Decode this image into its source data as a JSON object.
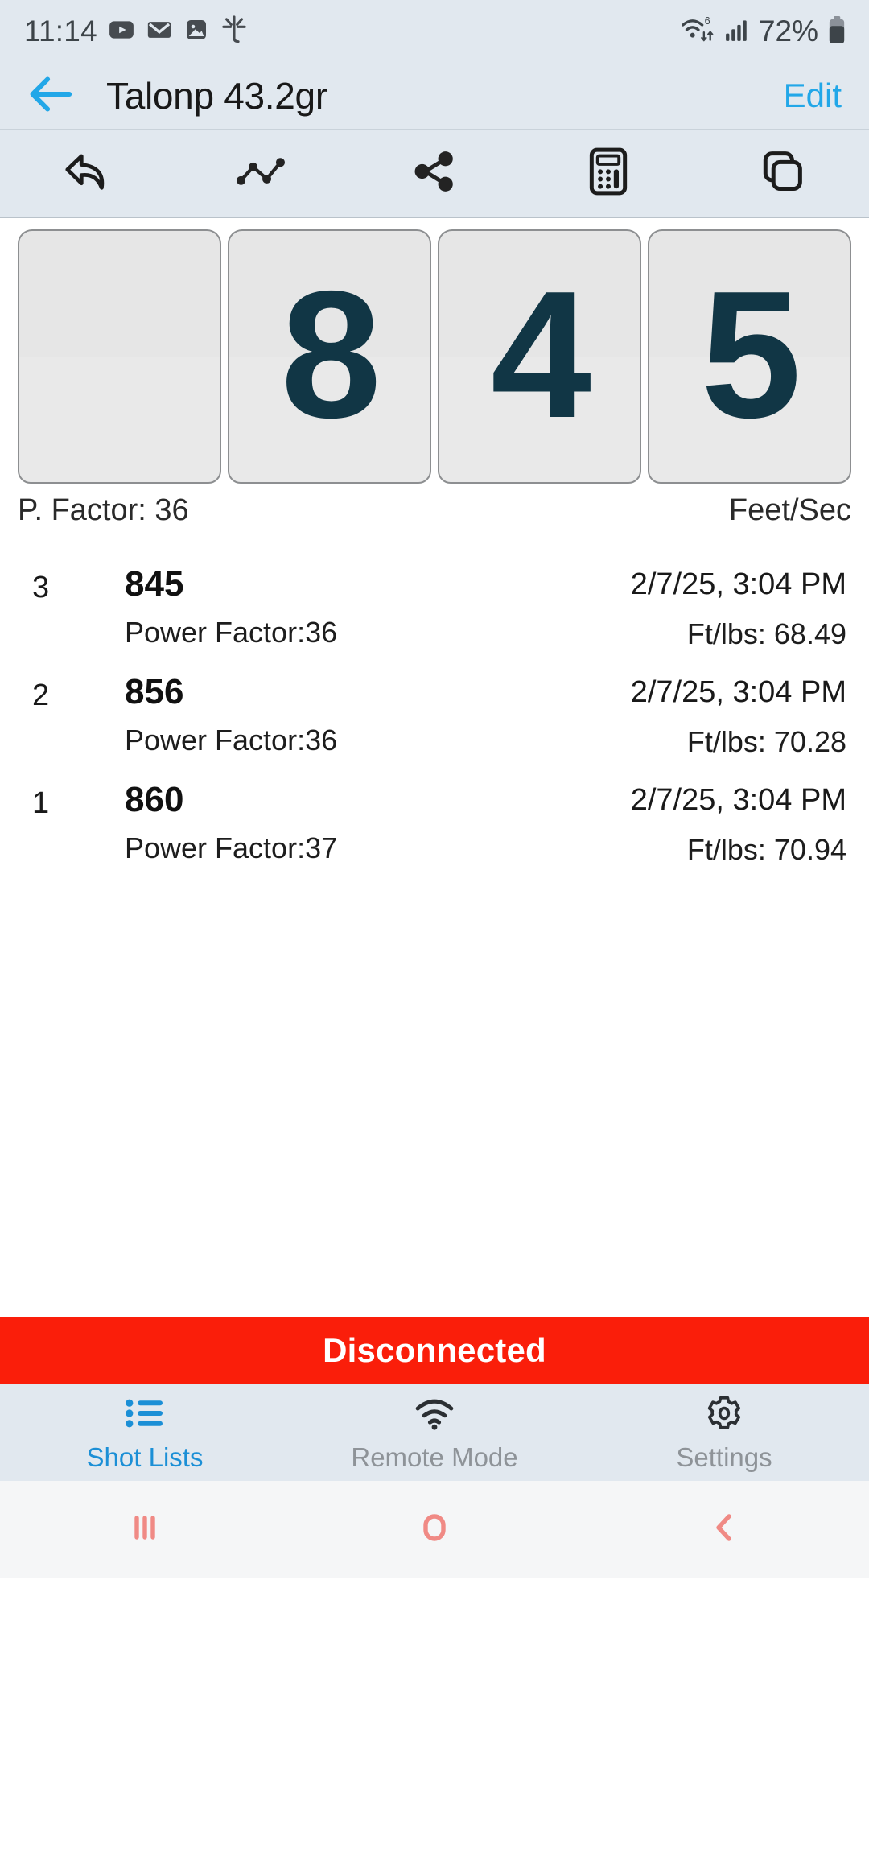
{
  "status_bar": {
    "time": "11:14",
    "battery_percent": "72%",
    "left_icons": [
      "youtube-icon",
      "email-icon",
      "gallery-image-icon",
      "spark-app-icon"
    ],
    "right_icons": [
      "wifi-6-icon",
      "cellular-signal-icon",
      "battery-icon"
    ]
  },
  "app_bar": {
    "back_icon": "back-arrow-icon",
    "title": "Talonp 43.2gr",
    "edit_label": "Edit",
    "accent_color": "#22a7e8",
    "background": "#e1e8ef"
  },
  "toolbar": {
    "items": [
      {
        "icon": "undo-reply-arrow-icon",
        "name": "undo-button"
      },
      {
        "icon": "line-chart-icon",
        "name": "chart-button"
      },
      {
        "icon": "share-icon",
        "name": "share-button"
      },
      {
        "icon": "calculator-icon",
        "name": "calculator-button"
      },
      {
        "icon": "copy-duplicate-icon",
        "name": "duplicate-button"
      }
    ]
  },
  "speed_display": {
    "digits": [
      "",
      "8",
      "4",
      "5"
    ],
    "value": "845",
    "power_factor_label": "P. Factor: 36",
    "units_label": "Feet/Sec",
    "digit_color": "#113645"
  },
  "shot_list": {
    "rows": [
      {
        "index": "3",
        "speed": "845",
        "power_factor": "Power Factor:36",
        "date": "2/7/25, 3:04 PM",
        "energy": "Ft/lbs: 68.49"
      },
      {
        "index": "2",
        "speed": "856",
        "power_factor": "Power Factor:36",
        "date": "2/7/25, 3:04 PM",
        "energy": "Ft/lbs: 70.28"
      },
      {
        "index": "1",
        "speed": "860",
        "power_factor": "Power Factor:37",
        "date": "2/7/25, 3:04 PM",
        "energy": "Ft/lbs: 70.94"
      }
    ]
  },
  "connection_banner": {
    "text": "Disconnected",
    "background": "#fa1e0a",
    "text_color": "#ffffff"
  },
  "tab_bar": {
    "active_color": "#1b8fd6",
    "inactive_color": "#8e9398",
    "tabs": [
      {
        "label": "Shot Lists",
        "icon": "list-icon",
        "active": true
      },
      {
        "label": "Remote Mode",
        "icon": "wifi-icon",
        "active": false
      },
      {
        "label": "Settings",
        "icon": "gear-icon",
        "active": false
      }
    ]
  },
  "android_nav": {
    "button_color": "#f08a85",
    "buttons": [
      {
        "icon": "recents-icon",
        "name": "recents-button"
      },
      {
        "icon": "home-circle-icon",
        "name": "home-button"
      },
      {
        "icon": "back-chevron-icon",
        "name": "android-back-button"
      }
    ]
  }
}
